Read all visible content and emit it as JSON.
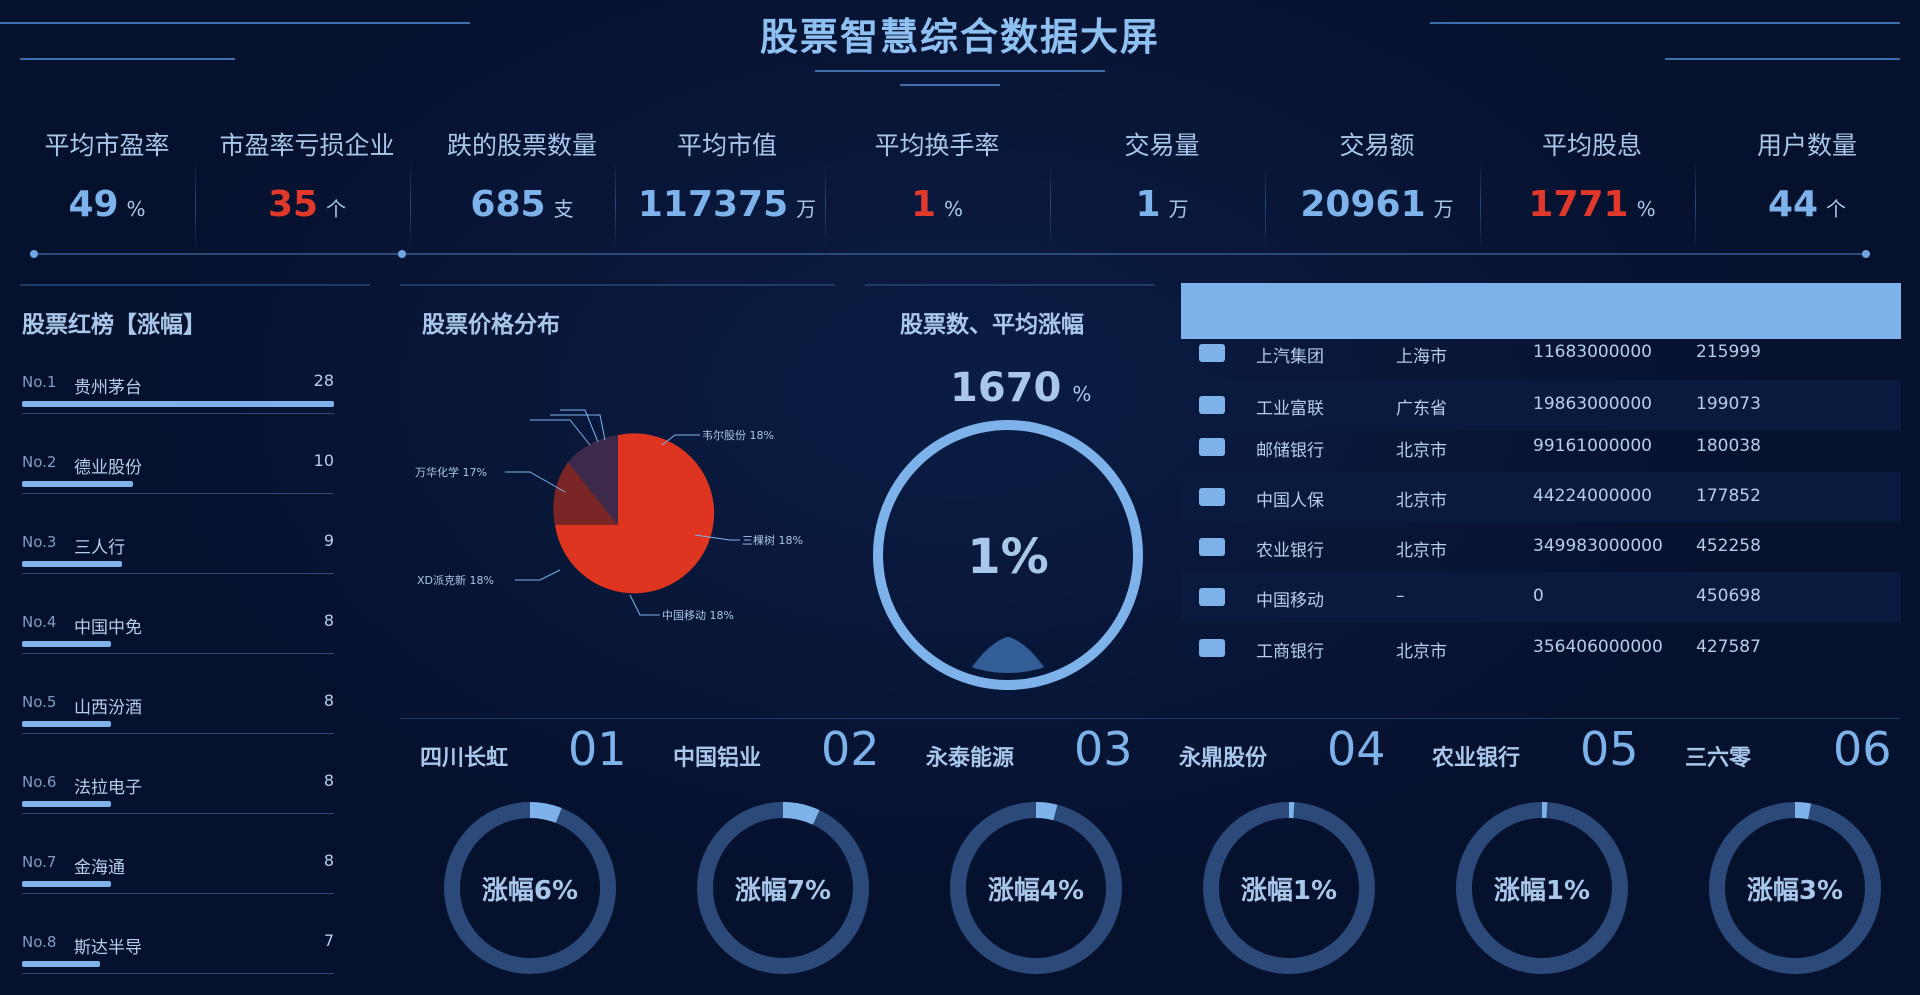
{
  "title": "股票智慧综合数据大屏",
  "kpis": [
    {
      "label": "平均市盈率",
      "value": "49",
      "unit": "%",
      "highlight": false
    },
    {
      "label": "市盈率亏损企业",
      "value": "35",
      "unit": "个",
      "highlight": true
    },
    {
      "label": "跌的股票数量",
      "value": "685",
      "unit": "支",
      "highlight": false
    },
    {
      "label": "平均市值",
      "value": "117375",
      "unit": "万",
      "highlight": false
    },
    {
      "label": "平均换手率",
      "value": "1",
      "unit": "%",
      "highlight": true
    },
    {
      "label": "交易量",
      "value": "1",
      "unit": "万",
      "highlight": false
    },
    {
      "label": "交易额",
      "value": "20961",
      "unit": "万",
      "highlight": false
    },
    {
      "label": "平均股息",
      "value": "1771",
      "unit": "%",
      "highlight": true
    },
    {
      "label": "用户数量",
      "value": "44",
      "unit": "个",
      "highlight": false
    }
  ],
  "ranking": {
    "title": "股票红榜【涨幅】",
    "max": 28,
    "items": [
      {
        "no": "No.1",
        "name": "贵州茅台",
        "value": 28
      },
      {
        "no": "No.2",
        "name": "德业股份",
        "value": 10
      },
      {
        "no": "No.3",
        "name": "三人行",
        "value": 9
      },
      {
        "no": "No.4",
        "name": "中国中免",
        "value": 8
      },
      {
        "no": "No.5",
        "name": "山西汾酒",
        "value": 8
      },
      {
        "no": "No.6",
        "name": "法拉电子",
        "value": 8
      },
      {
        "no": "No.7",
        "name": "金海通",
        "value": 8
      },
      {
        "no": "No.8",
        "name": "斯达半导",
        "value": 7
      }
    ]
  },
  "price_dist": {
    "title": "股票价格分布",
    "labels": [
      "韦尔股份 18%",
      "三棵树 18%",
      "中国移动 18%",
      "XD派克新 18%",
      "万华化学 17%"
    ]
  },
  "avg_gain": {
    "title": "股票数、平均涨幅",
    "count": "1670",
    "count_unit": "%",
    "ring_text": "1%",
    "level": 0.01
  },
  "table": {
    "rows": [
      {
        "name": "上汽集团",
        "region": "上海市",
        "amount": "11683000000",
        "value": "215999"
      },
      {
        "name": "工业富联",
        "region": "广东省",
        "amount": "19863000000",
        "value": "199073"
      },
      {
        "name": "邮储银行",
        "region": "北京市",
        "amount": "99161000000",
        "value": "180038"
      },
      {
        "name": "中国人保",
        "region": "北京市",
        "amount": "44224000000",
        "value": "177852"
      },
      {
        "name": "农业银行",
        "region": "北京市",
        "amount": "349983000000",
        "value": "452258"
      },
      {
        "name": "中国移动",
        "region": "–",
        "amount": "0",
        "value": "450698"
      },
      {
        "name": "工商银行",
        "region": "北京市",
        "amount": "356406000000",
        "value": "427587"
      }
    ]
  },
  "cards": [
    {
      "name": "四川长虹",
      "num": "01",
      "text": "涨幅6%",
      "pct": 6
    },
    {
      "name": "中国铝业",
      "num": "02",
      "text": "涨幅7%",
      "pct": 7
    },
    {
      "name": "永泰能源",
      "num": "03",
      "text": "涨幅4%",
      "pct": 4
    },
    {
      "name": "永鼎股份",
      "num": "04",
      "text": "涨幅1%",
      "pct": 1
    },
    {
      "name": "农业银行",
      "num": "05",
      "text": "涨幅1%",
      "pct": 1
    },
    {
      "name": "三六零",
      "num": "06",
      "text": "涨幅3%",
      "pct": 3
    }
  ],
  "colors": {
    "accent": "#7db3ea",
    "red": "#e0382a",
    "bg": "#06112e"
  }
}
